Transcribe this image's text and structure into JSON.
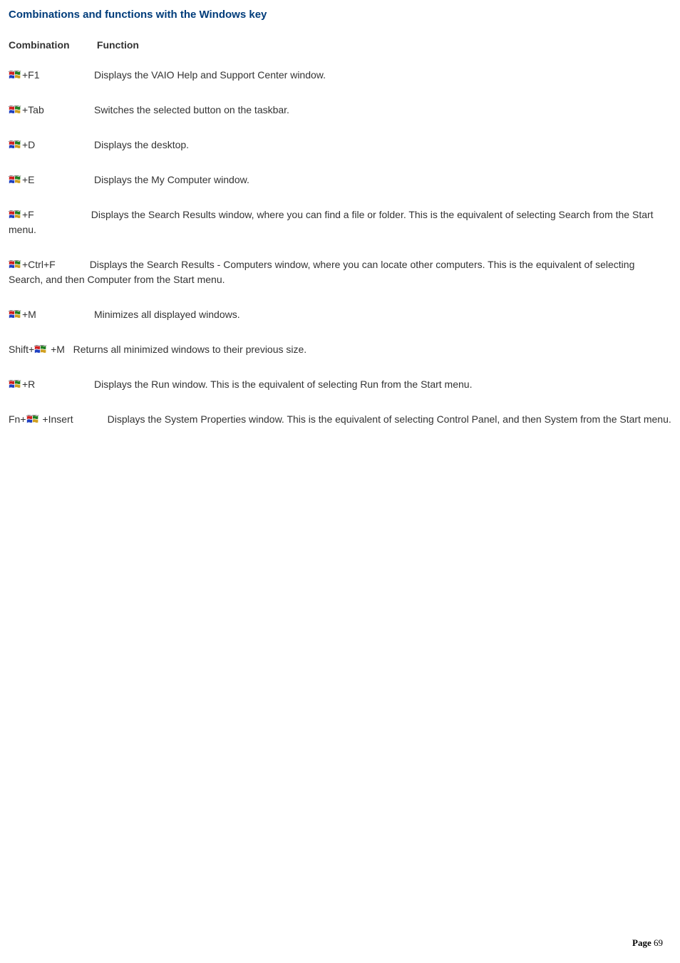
{
  "title": "Combinations and functions with the Windows key",
  "headers": {
    "combination": "Combination",
    "function": "Function"
  },
  "rows": [
    {
      "suffix": "+F1",
      "prefix": "",
      "func": "Displays the VAIO Help and Support Center window."
    },
    {
      "suffix": "+Tab",
      "prefix": "",
      "func": "Switches the selected button on the taskbar."
    },
    {
      "suffix": "+D",
      "prefix": "",
      "func": "Displays the desktop."
    },
    {
      "suffix": "+E",
      "prefix": "",
      "func": "Displays the My Computer window."
    },
    {
      "suffix": "+F",
      "prefix": "",
      "func": "Displays the Search Results window, where you can find a file or folder. This is the equivalent of selecting Search from the Start menu."
    },
    {
      "suffix": "+Ctrl+F",
      "prefix": "",
      "func": "Displays the Search Results - Computers window, where you can locate other computers. This is the equivalent of selecting Search, and then Computer from the Start menu."
    },
    {
      "suffix": "+M",
      "prefix": "",
      "func": "Minimizes all displayed windows."
    },
    {
      "suffix": " +M",
      "prefix": "Shift+",
      "func": "Returns all minimized windows to their previous size."
    },
    {
      "suffix": "+R",
      "prefix": "",
      "func": "Displays the Run window. This is the equivalent of selecting Run from the Start menu."
    },
    {
      "suffix": " +Insert",
      "prefix": "Fn+",
      "func": "Displays the System Properties window. This is the equivalent of selecting Control Panel, and then System from the Start menu."
    }
  ],
  "page_label": "Page",
  "page_number": "69"
}
